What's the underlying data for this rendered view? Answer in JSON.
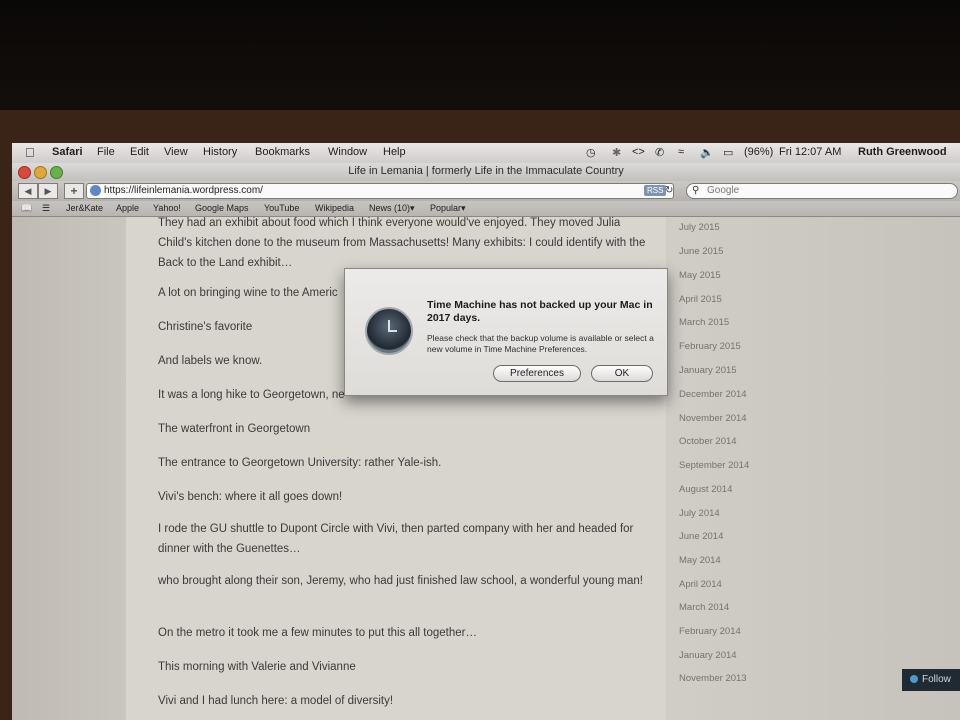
{
  "menubar": {
    "app": "Safari",
    "items": [
      "File",
      "Edit",
      "View",
      "History",
      "Bookmarks",
      "Window",
      "Help"
    ],
    "battery": "(96%)",
    "clock": "Fri 12:07 AM",
    "user": "Ruth Greenwood"
  },
  "window": {
    "title": "Life in Lemania | formerly Life in the Immaculate Country",
    "url": "https://lifeinlemania.wordpress.com/",
    "rss": "RSS",
    "search_placeholder": "Google"
  },
  "bookmarks": [
    "Jer&Kate",
    "Apple",
    "Yahoo!",
    "Google Maps",
    "YouTube",
    "Wikipedia",
    "News (10)▾",
    "Popular▾"
  ],
  "post": {
    "paragraphs": [
      "They had an exhibit about food which I think everyone would've enjoyed. They moved Julia Child's kitchen done to the museum from Massachusetts! Many exhibits: I could identify with the Back to the Land exhibit…",
      "A lot on bringing wine to the Americ",
      "Christine's favorite",
      "And labels we know.",
      "It was a long hike to Georgetown, ne",
      "The waterfront in Georgetown",
      "The entrance to Georgetown University: rather Yale-ish.",
      "Vivi's bench: where it all goes down!",
      "I rode the GU shuttle to Dupont Circle with Vivi, then parted company with her and headed for dinner with the Guenettes…",
      "who brought along their son, Jeremy, who had just finished law school, a wonderful young man!",
      "On the metro it took me a few minutes to put this all together…",
      "This morning with Valerie and Vivianne",
      "Vivi and I had lunch here: a model of diversity!"
    ]
  },
  "archives": [
    "July 2015",
    "June 2015",
    "May 2015",
    "April 2015",
    "March 2015",
    "February 2015",
    "January 2015",
    "December 2014",
    "November 2014",
    "October 2014",
    "September 2014",
    "August 2014",
    "July 2014",
    "June 2014",
    "May 2014",
    "April 2014",
    "March 2014",
    "February 2014",
    "January 2014",
    "November 2013"
  ],
  "follow_label": "Follow",
  "dialog": {
    "title": "Time Machine has not backed up your Mac in 2017 days.",
    "message": "Please check that the backup volume is available or select a new volume in Time Machine Preferences.",
    "preferences_label": "Preferences",
    "ok_label": "OK"
  }
}
